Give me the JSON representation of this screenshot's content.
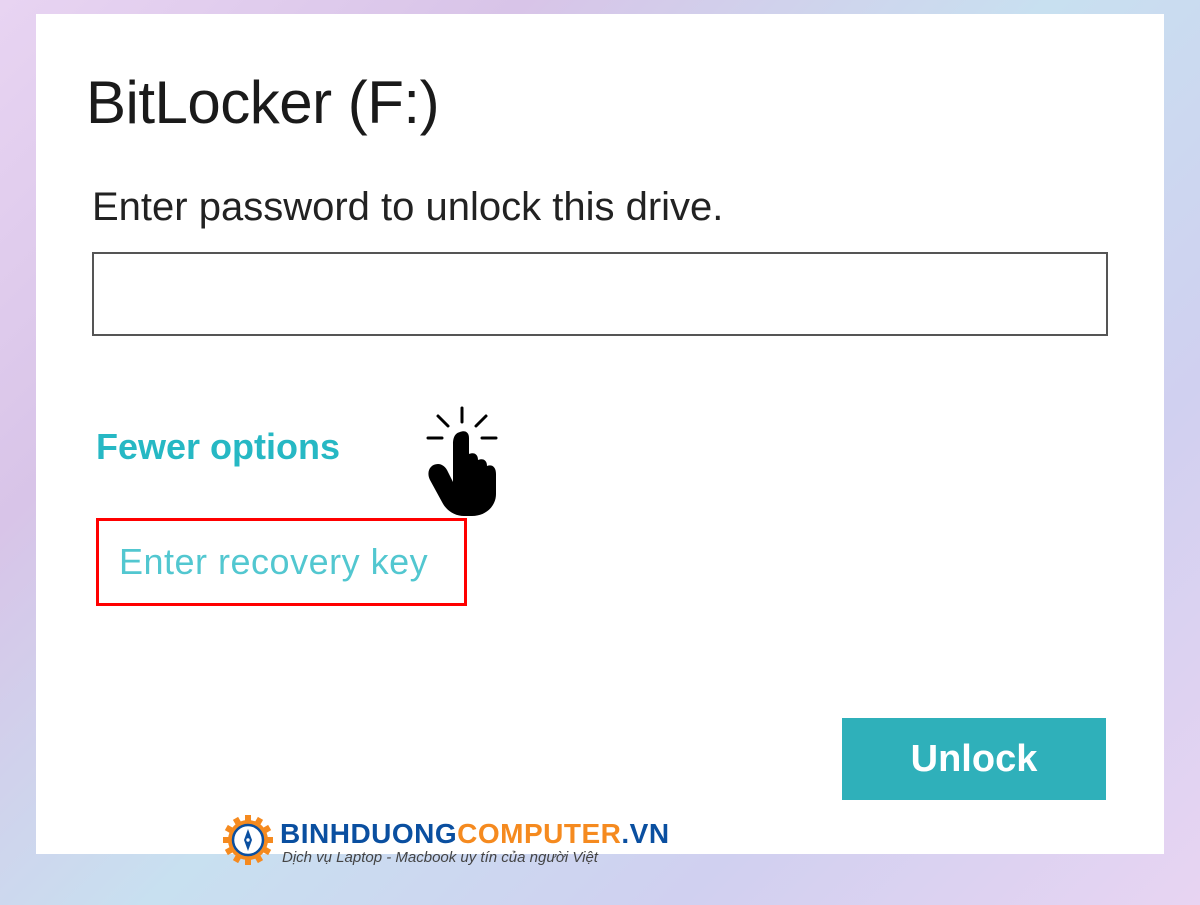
{
  "dialog": {
    "title": "BitLocker (F:)",
    "prompt": "Enter password to unlock this drive.",
    "password_value": "",
    "fewer_options_label": "Fewer options",
    "recovery_label": "Enter recovery key",
    "unlock_label": "Unlock"
  },
  "watermark": {
    "brand_part1": "BINHDUONG",
    "brand_part2": "COMPUTER",
    "brand_part3": ".VN",
    "tagline": "Dịch vụ Laptop - Macbook uy tín của người Việt"
  },
  "colors": {
    "link_teal": "#26b8c4",
    "button_teal": "#2fb0ba",
    "highlight_red": "#ff0000",
    "brand_blue": "#0a4fa0",
    "brand_orange": "#f58a1f"
  }
}
